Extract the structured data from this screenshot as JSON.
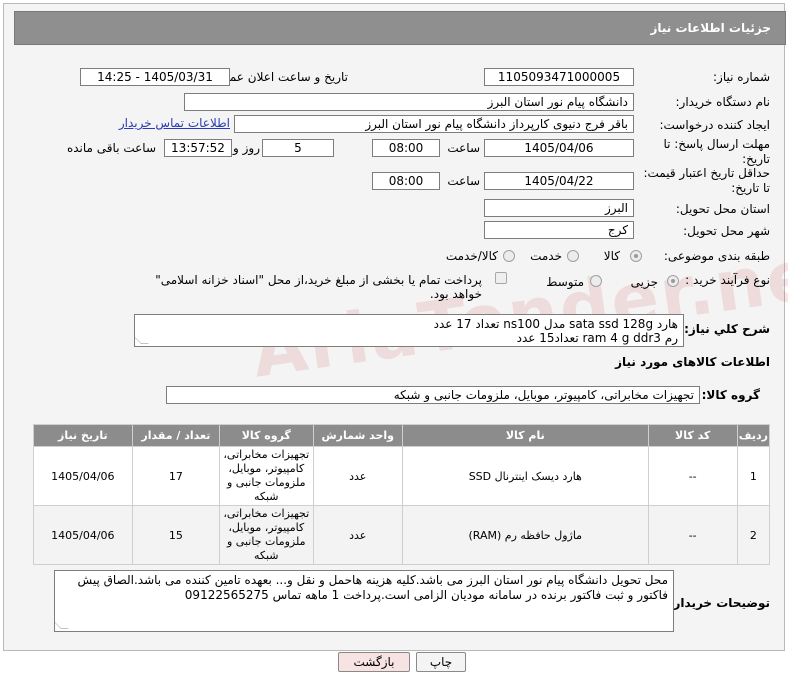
{
  "header": {
    "title": "جزئیات اطلاعات نیاز"
  },
  "fields": {
    "need_number_label": "شماره نیاز:",
    "need_number": "1105093471000005",
    "announce_label": "تاریخ و ساعت اعلان عمومی:",
    "announce_value": "1405/03/31 - 14:25",
    "buyer_org_label": "نام دستگاه خریدار:",
    "buyer_org": "دانشگاه پیام نور استان البرز",
    "creator_label": "ایجاد کننده درخواست:",
    "creator": "باقر فرج دنیوی کارپرداز دانشگاه پیام نور استان البرز",
    "contact_link": "اطلاعات تماس خریدار",
    "reply_deadline_label": "مهلت ارسال پاسخ: تا تاریخ:",
    "reply_date": "1405/04/06",
    "time_word": "ساعت",
    "reply_time": "08:00",
    "days_value": "5",
    "days_word": "روز و",
    "remaining_time": "13:57:52",
    "remaining_word": "ساعت باقی مانده",
    "price_validity_label": "حداقل تاریخ اعتبار قیمت: تا تاریخ:",
    "price_date": "1405/04/22",
    "price_time": "08:00",
    "province_label": "استان محل تحویل:",
    "province": "البرز",
    "city_label": "شهر محل تحویل:",
    "city": "کرج",
    "category_label": "طبقه بندی موضوعی:",
    "category_options": [
      "کالا",
      "خدمت",
      "کالا/خدمت"
    ],
    "purchase_type_label": "نوع فرآیند خرید :",
    "purchase_options": [
      "جزیی",
      "متوسط"
    ],
    "payment_note": "پرداخت تمام یا بخشی از مبلغ خرید،از محل \"اسناد خزانه اسلامی\" خواهد بود.",
    "description_label": "شرح کلي نياز:",
    "description_line1": "هارد sata   ssd 128g مدل ns100 تعداد 17 عدد",
    "description_line2": "رم ram 4 g ddr3  تعداد15 عدد",
    "goods_info_title": "اطلاعات کالاهای مورد نیاز",
    "goods_group_label": "گروه کالا:",
    "goods_group": "تجهیزات مخابراتی، کامپیوتر، موبایل، ملزومات جانبی و شبکه",
    "buyer_notes_label": "توضیحات خریدار:",
    "buyer_notes": "محل تحویل دانشگاه پیام نور استان البرز می باشد.کلیه هزینه هاحمل و نقل و... بعهده تامین کننده می باشد.الصاق پیش فاکتور و ثبت فاکتور برنده در سامانه مودیان الزامی است.پرداخت 1 ماهه تماس 09122565275"
  },
  "table": {
    "headers": [
      "ردیف",
      "کد کالا",
      "نام کالا",
      "واحد شمارش",
      "گروه کالا",
      "تعداد / مقدار",
      "تاریخ نیاز"
    ],
    "rows": [
      {
        "idx": "1",
        "code": "--",
        "name": "هارد دیسک اینترنال SSD",
        "unit": "عدد",
        "group": "تجهیزات مخابراتی، کامپیوتر، موبایل، ملزومات جانبی و شبکه",
        "qty": "17",
        "date": "1405/04/06"
      },
      {
        "idx": "2",
        "code": "--",
        "name": "ماژول حافظه رم (RAM)",
        "unit": "عدد",
        "group": "تجهیزات مخابراتی، کامپیوتر، موبایل، ملزومات جانبی و شبکه",
        "qty": "15",
        "date": "1405/04/06"
      }
    ]
  },
  "buttons": {
    "print": "چاپ",
    "back": "بازگشت"
  },
  "watermark": "AriaTender.net",
  "colors": {
    "header_bg": "#8f8f8f",
    "link": "#2a3bb5",
    "back_button_bg": "#f8e3e3"
  }
}
